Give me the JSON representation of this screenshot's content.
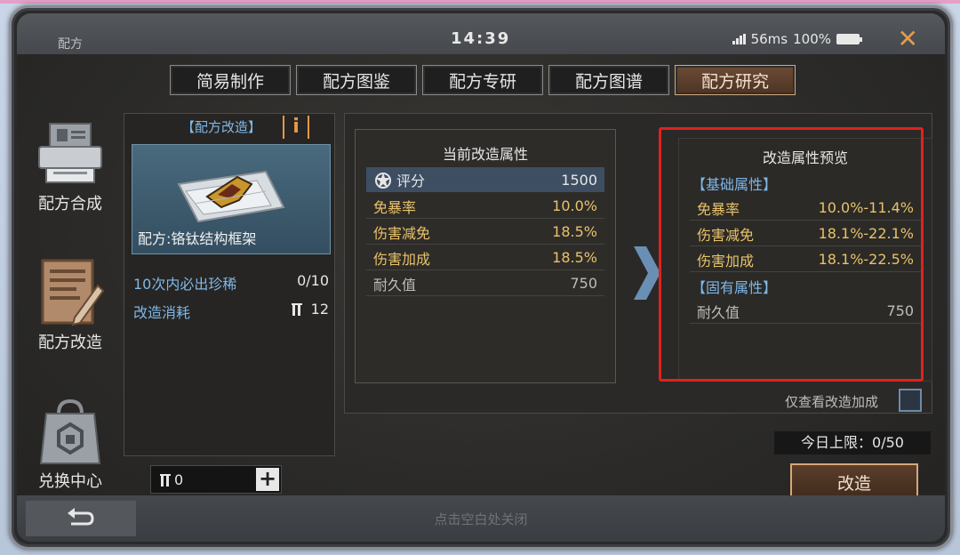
{
  "window": {
    "title": "配方",
    "clock": "14:39",
    "ping": "56ms",
    "battery": "100%"
  },
  "tabs": [
    {
      "label": "简易制作",
      "active": false
    },
    {
      "label": "配方图鉴",
      "active": false
    },
    {
      "label": "配方专研",
      "active": false
    },
    {
      "label": "配方图谱",
      "active": false
    },
    {
      "label": "配方研究",
      "active": true
    }
  ],
  "sidebar": {
    "items": [
      {
        "label": "配方合成",
        "icon": "printer-icon"
      },
      {
        "label": "配方改造",
        "icon": "notepad-pencil-icon"
      },
      {
        "label": "兑换中心",
        "icon": "shopping-bag-icon"
      }
    ]
  },
  "recipe": {
    "header": "【配方改造】",
    "name": "配方:铬钛结构框架",
    "guarantee_label": "10次内必出珍稀",
    "guarantee_value": "0/10",
    "cost_label": "改造消耗",
    "cost_value": "12",
    "quantity": "0"
  },
  "current_attrs": {
    "title": "当前改造属性",
    "score_label": "评分",
    "score_value": "1500",
    "rows": [
      {
        "label": "免暴率",
        "value": "10.0%"
      },
      {
        "label": "伤害减免",
        "value": "18.5%"
      },
      {
        "label": "伤害加成",
        "value": "18.5%"
      },
      {
        "label": "耐久值",
        "value": "750"
      }
    ]
  },
  "preview_attrs": {
    "title": "改造属性预览",
    "basic_label": "【基础属性】",
    "basic_rows": [
      {
        "label": "免暴率",
        "value": "10.0%-11.4%"
      },
      {
        "label": "伤害减免",
        "value": "18.1%-22.1%"
      },
      {
        "label": "伤害加成",
        "value": "18.1%-22.5%"
      }
    ],
    "fixed_label": "【固有属性】",
    "fixed_rows": [
      {
        "label": "耐久值",
        "value": "750"
      }
    ]
  },
  "only_view_label": "仅查看改造加成",
  "daily_limit": "今日上限：0/50",
  "modify_button": "改造",
  "tap_close": "点击空白处关闭",
  "colors": {
    "accent_orange": "#e39a4a",
    "label_blue": "#7fb7e8",
    "value_gold": "#e8c26a",
    "highlight_red": "#e0221e"
  }
}
